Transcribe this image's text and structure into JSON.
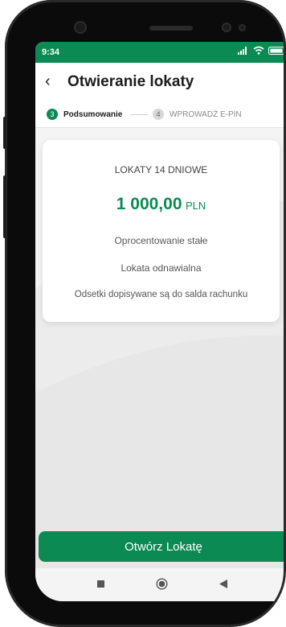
{
  "status_bar": {
    "time": "9:34",
    "signal_icon": "signal-icon",
    "wifi_icon": "wifi-icon",
    "battery_icon": "battery-icon"
  },
  "header": {
    "back_icon": "back-arrow-icon",
    "title": "Otwieranie lokaty"
  },
  "stepper": {
    "steps": [
      {
        "number": "3",
        "label": "Podsumowanie",
        "active": true
      },
      {
        "number": "4",
        "label": "WPROWADŹ E-PIN",
        "active": false
      }
    ]
  },
  "summary": {
    "deposit_name": "LOKATY 14 DNIOWE",
    "amount": "1 000,00",
    "currency": "PLN",
    "interest_type": "Oprocentowanie stałe",
    "renewal": "Lokata odnawialna",
    "interest_payout": "Odsetki dopisywane są do salda rachunku"
  },
  "action": {
    "open_button_label": "Otwórz Lokatę"
  },
  "colors": {
    "brand_green": "#0b8a53",
    "background": "#f3f4f3",
    "card": "#ffffff"
  },
  "nav_bar": {
    "recents_icon": "square-icon",
    "home_icon": "home-circle-icon",
    "back_icon": "triangle-back-icon"
  }
}
